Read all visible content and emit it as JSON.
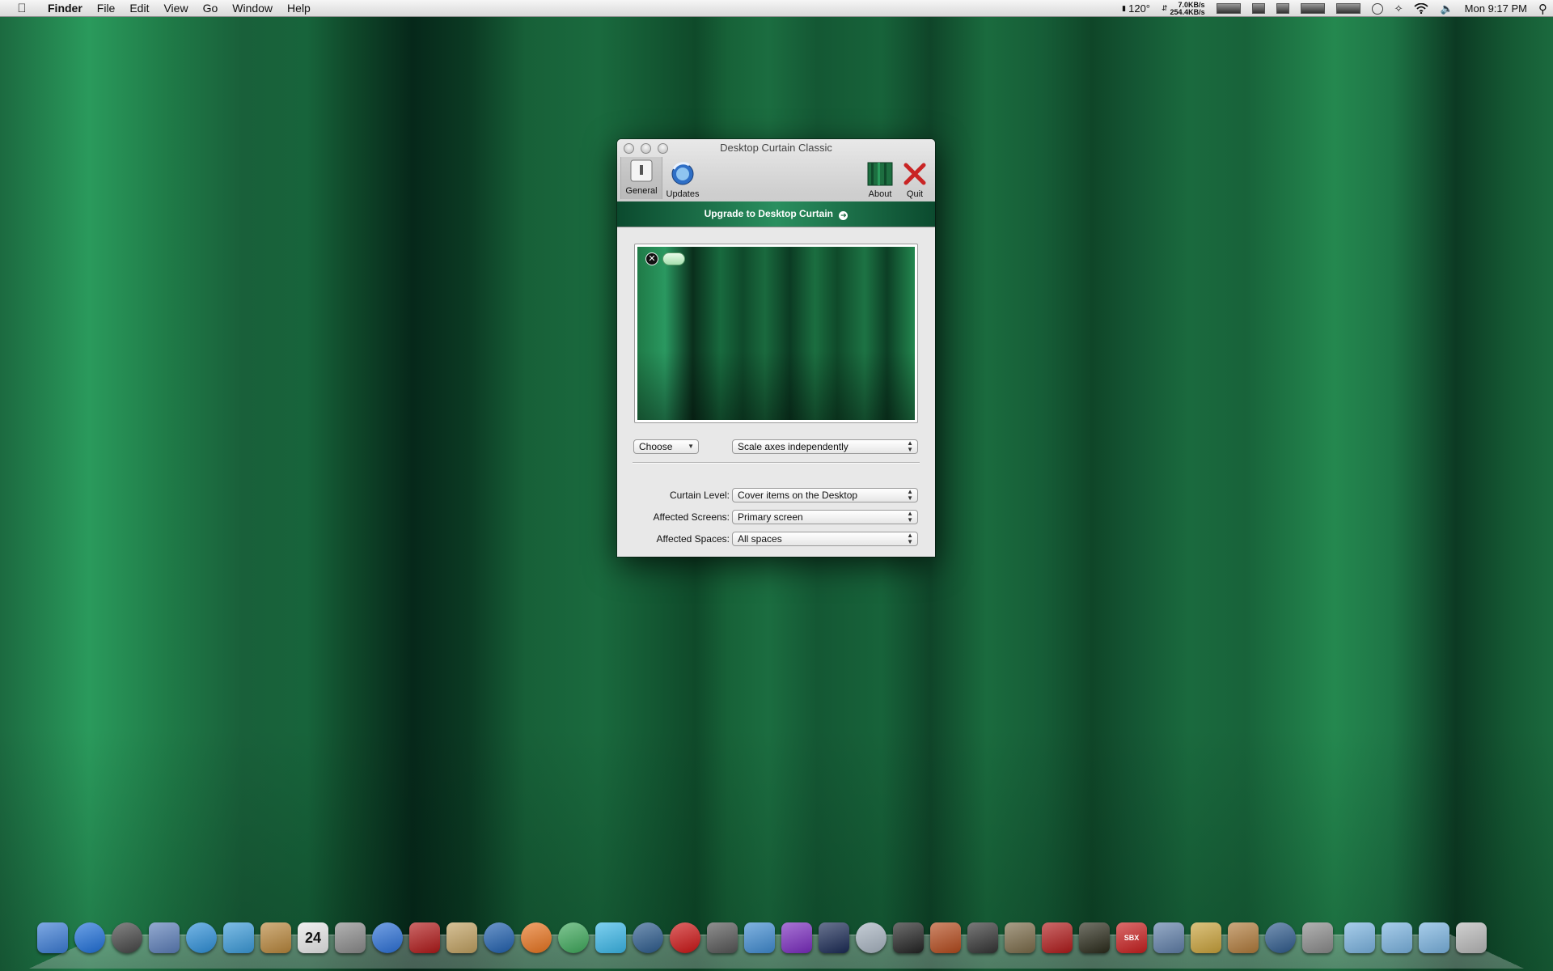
{
  "menubar": {
    "app_name": "Finder",
    "items": [
      "File",
      "Edit",
      "View",
      "Go",
      "Window",
      "Help"
    ],
    "status": {
      "temperature": "120°",
      "net_up": "7.0KB/s",
      "net_down": "254.4KB/s",
      "clock": "Mon 9:17 PM"
    }
  },
  "window": {
    "title": "Desktop Curtain Classic",
    "toolbar": {
      "general": "General",
      "updates": "Updates",
      "about": "About",
      "quit": "Quit"
    },
    "upgrade_banner": "Upgrade to Desktop Curtain",
    "image_controls": {
      "choose": "Choose",
      "scale_mode": "Scale axes independently"
    },
    "settings": {
      "curtain_level_label": "Curtain Level:",
      "curtain_level_value": "Cover items on the Desktop",
      "affected_screens_label": "Affected Screens:",
      "affected_screens_value": "Primary screen",
      "affected_spaces_label": "Affected Spaces:",
      "affected_spaces_value": "All spaces"
    }
  },
  "dock": {
    "calendar_day": "24",
    "sbx_label": "SBX",
    "icons": [
      {
        "name": "finder-icon",
        "color": "#3a7bd5"
      },
      {
        "name": "app-store-icon",
        "color": "#1e6fd9"
      },
      {
        "name": "dashboard-icon",
        "color": "#444444"
      },
      {
        "name": "mail-stamp-icon",
        "color": "#5b7db8"
      },
      {
        "name": "safari-icon",
        "color": "#2d8fd8"
      },
      {
        "name": "facetime-icon",
        "color": "#3a9ad9"
      },
      {
        "name": "address-book-icon",
        "color": "#b8863b"
      },
      {
        "name": "calendar-icon",
        "color": "#e8e8e8"
      },
      {
        "name": "preview-icon",
        "color": "#8a8a8a"
      },
      {
        "name": "itunes-icon",
        "color": "#2a6fd6"
      },
      {
        "name": "photo-booth-icon",
        "color": "#b01818"
      },
      {
        "name": "iphoto-icon",
        "color": "#c0a060"
      },
      {
        "name": "quicktime-icon",
        "color": "#1f5fae"
      },
      {
        "name": "firefox-icon",
        "color": "#e8731e"
      },
      {
        "name": "chrome-icon",
        "color": "#3da85a"
      },
      {
        "name": "bird-app-icon",
        "color": "#3ab7e8"
      },
      {
        "name": "globe-app-icon",
        "color": "#2b5a8c"
      },
      {
        "name": "opera-icon",
        "color": "#cc1414"
      },
      {
        "name": "grid-app-icon",
        "color": "#555555"
      },
      {
        "name": "twitter-icon",
        "color": "#3f8bd1"
      },
      {
        "name": "purple-app-icon",
        "color": "#7a2bbf"
      },
      {
        "name": "galaxy-app-icon",
        "color": "#1a2a55"
      },
      {
        "name": "compass-app-icon",
        "color": "#a7b3c0"
      },
      {
        "name": "penguin-app-icon",
        "color": "#222222"
      },
      {
        "name": "game-app-icon",
        "color": "#b44a1c"
      },
      {
        "name": "binoculars-app-icon",
        "color": "#333333"
      },
      {
        "name": "soldier-app-icon",
        "color": "#7a6a48"
      },
      {
        "name": "wolfenstein-icon",
        "color": "#b01a1a"
      },
      {
        "name": "radar-app-icon",
        "color": "#2a2a1a"
      },
      {
        "name": "sbx-app-icon",
        "color": "#c81e1e"
      },
      {
        "name": "windows-app-icon",
        "color": "#5f7ea8"
      },
      {
        "name": "imovie-star-icon",
        "color": "#c9a23a"
      },
      {
        "name": "garageband-icon",
        "color": "#b07a3a"
      },
      {
        "name": "time-machine-icon",
        "color": "#2e5a8c"
      },
      {
        "name": "system-preferences-icon",
        "color": "#8a8a8a"
      },
      {
        "name": "applications-folder-icon",
        "color": "#7ab3e0"
      },
      {
        "name": "documents-folder-icon",
        "color": "#7ab3e0"
      },
      {
        "name": "downloads-folder-icon",
        "color": "#7ab3e0"
      },
      {
        "name": "trash-icon",
        "color": "#b8b8b8"
      }
    ]
  }
}
